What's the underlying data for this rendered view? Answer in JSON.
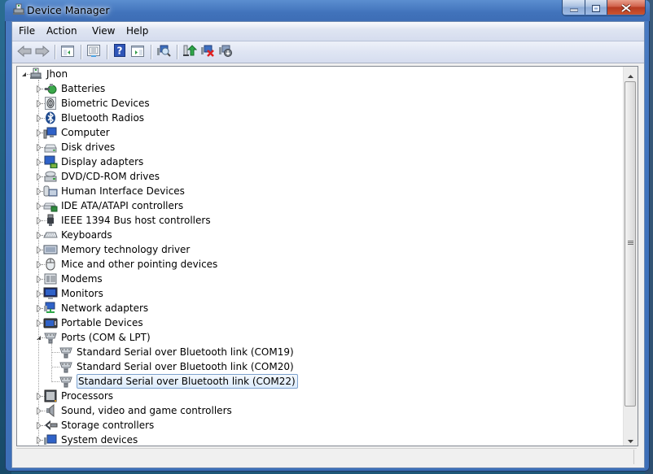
{
  "window": {
    "title": "Device Manager",
    "controls": {
      "minimize": "minimize",
      "maximize": "maximize",
      "close": "close"
    }
  },
  "menu": [
    {
      "label": "File"
    },
    {
      "label": "Action"
    },
    {
      "label": "View"
    },
    {
      "label": "Help"
    }
  ],
  "toolbar": [
    {
      "icon": "back-arrow-icon",
      "tooltip": "Back"
    },
    {
      "icon": "forward-arrow-icon",
      "tooltip": "Forward"
    },
    {
      "icon": "show-hide-console-tree-icon",
      "tooltip": "Show/Hide Console Tree"
    },
    {
      "icon": "properties-icon",
      "tooltip": "Properties"
    },
    {
      "icon": "help-icon",
      "tooltip": "Help"
    },
    {
      "icon": "show-hide-action-pane-icon",
      "tooltip": "Show/Hide Action Pane"
    },
    {
      "icon": "scan-hardware-icon",
      "tooltip": "Scan for hardware changes"
    },
    {
      "icon": "update-driver-icon",
      "tooltip": "Update Driver Software"
    },
    {
      "icon": "disable-device-icon",
      "tooltip": "Disable"
    },
    {
      "icon": "uninstall-device-icon",
      "tooltip": "Uninstall"
    }
  ],
  "tree": {
    "root": {
      "label": "Jhon",
      "icon": "computer-root-icon",
      "expanded": true
    },
    "categories": [
      {
        "label": "Batteries",
        "icon": "battery-icon",
        "expanded": false
      },
      {
        "label": "Biometric Devices",
        "icon": "fingerprint-icon",
        "expanded": false
      },
      {
        "label": "Bluetooth Radios",
        "icon": "bluetooth-icon",
        "expanded": false
      },
      {
        "label": "Computer",
        "icon": "computer-icon",
        "expanded": false
      },
      {
        "label": "Disk drives",
        "icon": "disk-drive-icon",
        "expanded": false
      },
      {
        "label": "Display adapters",
        "icon": "display-adapter-icon",
        "expanded": false
      },
      {
        "label": "DVD/CD-ROM drives",
        "icon": "dvd-drive-icon",
        "expanded": false
      },
      {
        "label": "Human Interface Devices",
        "icon": "hid-icon",
        "expanded": false
      },
      {
        "label": "IDE ATA/ATAPI controllers",
        "icon": "ide-controller-icon",
        "expanded": false
      },
      {
        "label": "IEEE 1394 Bus host controllers",
        "icon": "firewire-icon",
        "expanded": false
      },
      {
        "label": "Keyboards",
        "icon": "keyboard-icon",
        "expanded": false
      },
      {
        "label": "Memory technology driver",
        "icon": "memory-icon",
        "expanded": false
      },
      {
        "label": "Mice and other pointing devices",
        "icon": "mouse-icon",
        "expanded": false
      },
      {
        "label": "Modems",
        "icon": "modem-icon",
        "expanded": false
      },
      {
        "label": "Monitors",
        "icon": "monitor-icon",
        "expanded": false
      },
      {
        "label": "Network adapters",
        "icon": "network-adapter-icon",
        "expanded": false
      },
      {
        "label": "Portable Devices",
        "icon": "portable-device-icon",
        "expanded": false
      },
      {
        "label": "Ports (COM & LPT)",
        "icon": "port-icon",
        "expanded": true,
        "children": [
          {
            "label": "Standard Serial over Bluetooth link (COM19)",
            "icon": "port-icon",
            "selected": false
          },
          {
            "label": "Standard Serial over Bluetooth link (COM20)",
            "icon": "port-icon",
            "selected": false
          },
          {
            "label": "Standard Serial over Bluetooth link (COM22)",
            "icon": "port-icon",
            "selected": true
          }
        ]
      },
      {
        "label": "Processors",
        "icon": "processor-icon",
        "expanded": false
      },
      {
        "label": "Sound, video and game controllers",
        "icon": "speaker-icon",
        "expanded": false
      },
      {
        "label": "Storage controllers",
        "icon": "storage-controller-icon",
        "expanded": false
      },
      {
        "label": "System devices",
        "icon": "system-device-icon",
        "expanded": false
      }
    ]
  },
  "colors": {
    "selection_border": "#7da2ce",
    "selection_fill": "#dcebfc",
    "titlebar": "#4173bb",
    "close_button": "#c9552f"
  }
}
